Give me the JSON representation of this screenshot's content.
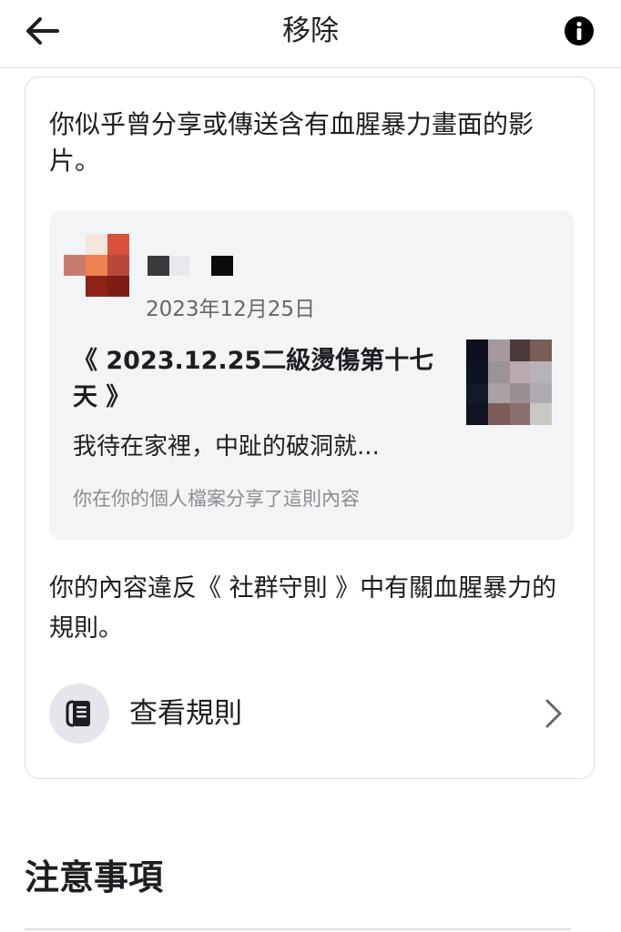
{
  "header": {
    "title": "移除",
    "back_icon": "arrow-left-icon",
    "info_icon": "info-icon"
  },
  "notice": {
    "text": "你似乎曾分享或傳送含有血腥暴力畫面的影片。"
  },
  "post": {
    "date": "2023年12月25日",
    "title": "《 2023.12.25二級燙傷第十七天 》",
    "excerpt": "我待在家裡，中趾的破洞就...",
    "shared_note": "你在你的個人檔案分享了這則內容"
  },
  "violation": {
    "text": "你的內容違反《 社群守則 》中有關血腥暴力的規則。"
  },
  "rules_link": {
    "label": "查看規則",
    "icon": "rules-book-icon",
    "chevron_icon": "chevron-right-icon"
  },
  "section": {
    "heading": "注意事項"
  },
  "colors": {
    "text": "#1c1e21",
    "secondary_text": "#65676b",
    "preview_bg": "#f2f4f6",
    "divider": "#dadde1"
  }
}
